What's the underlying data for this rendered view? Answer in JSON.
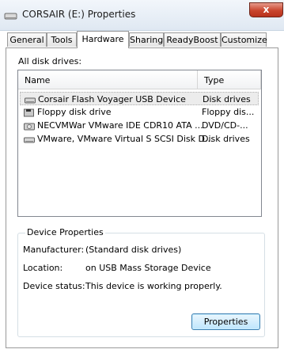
{
  "window": {
    "title": "CORSAIR (E:) Properties",
    "close_glyph": "x"
  },
  "tabs": [
    {
      "label": "General"
    },
    {
      "label": "Tools"
    },
    {
      "label": "Hardware"
    },
    {
      "label": "Sharing"
    },
    {
      "label": "ReadyBoost"
    },
    {
      "label": "Customize"
    }
  ],
  "active_tab": "Hardware",
  "drives_label": "All disk drives:",
  "columns": {
    "name": "Name",
    "type": "Type"
  },
  "drives": [
    {
      "name": "Corsair Flash Voyager USB Device",
      "type": "Disk drives",
      "icon": "usb-drive-icon"
    },
    {
      "name": "Floppy disk drive",
      "type": "Floppy dis...",
      "icon": "floppy-drive-icon"
    },
    {
      "name": "NECVMWar VMware IDE CDR10 ATA ...",
      "type": "DVD/CD-...",
      "icon": "cd-drive-icon"
    },
    {
      "name": "VMware, VMware Virtual S SCSI Disk D...",
      "type": "Disk drives",
      "icon": "disk-drive-icon"
    }
  ],
  "selected_drive": "Corsair Flash Voyager USB Device",
  "device_properties": {
    "legend": "Device Properties",
    "manufacturer_label": "Manufacturer:",
    "manufacturer": "(Standard disk drives)",
    "location_label": "Location:",
    "location": "on USB Mass Storage Device",
    "status_label": "Device status:",
    "status": "This device is working properly.",
    "button": "Properties"
  },
  "colors": {
    "close_button": "#c9452d",
    "button_border": "#3c7fb1",
    "selection": "#ececec"
  }
}
